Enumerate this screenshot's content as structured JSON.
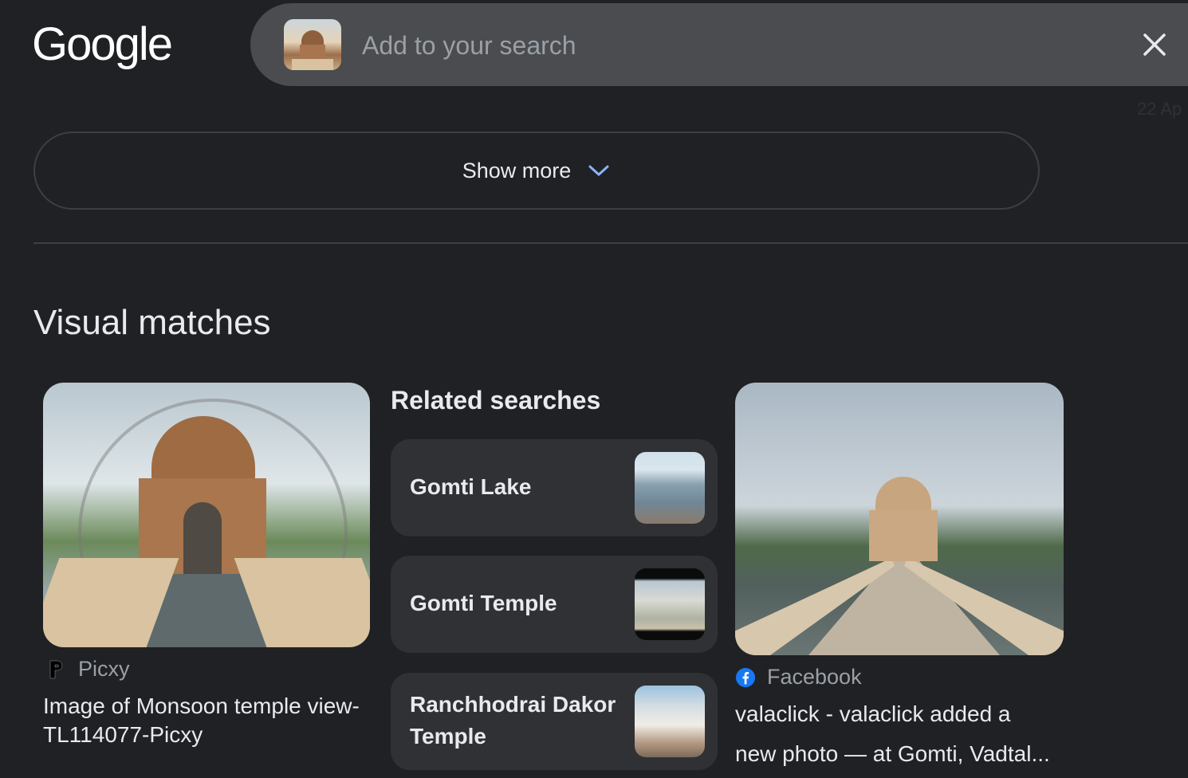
{
  "header": {
    "logo": "Google",
    "search": {
      "placeholder": "Add to your search",
      "value": ""
    },
    "faint_date": "22 Ap"
  },
  "show_more": {
    "label": "Show more"
  },
  "visual_matches": {
    "title": "Visual matches",
    "results": [
      {
        "source": "Picxy",
        "caption_line1": "Image of Monsoon temple view-",
        "caption_line2": "TL114077-Picxy"
      },
      {
        "source": "Facebook",
        "caption_line1": "valaclick - valaclick added a",
        "caption_line2": "new photo — at Gomti, Vadtal..."
      }
    ]
  },
  "related_searches": {
    "title": "Related searches",
    "items": [
      {
        "label": "Gomti Lake"
      },
      {
        "label": "Gomti Temple"
      },
      {
        "label_line1": "Ranchhodrai Dakor",
        "label_line2": "Temple"
      }
    ]
  },
  "colors": {
    "background": "#202124",
    "search_bar": "#4a4c50",
    "card": "#303134",
    "chevron": "#8ab4f8",
    "facebook": "#1877f2"
  },
  "icons": {
    "close": "close-icon",
    "chevron": "chevron-down-icon",
    "picxy": "picxy-logo-icon",
    "facebook": "facebook-icon"
  }
}
